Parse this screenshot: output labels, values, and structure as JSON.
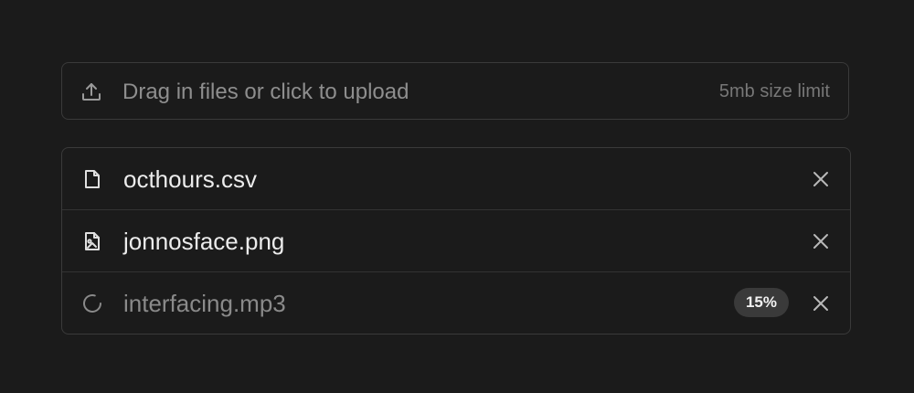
{
  "upload": {
    "prompt": "Drag in files or click to upload",
    "limit": "5mb size limit",
    "icon": "upload-icon"
  },
  "files": [
    {
      "name": "octhours.csv",
      "icon": "file-icon",
      "status": "complete"
    },
    {
      "name": "jonnosface.png",
      "icon": "image-file-icon",
      "status": "complete"
    },
    {
      "name": "interfacing.mp3",
      "icon": "spinner-icon",
      "status": "uploading",
      "progress_label": "15%",
      "progress": 0.15
    }
  ],
  "colors": {
    "background": "#1b1b1b",
    "border": "#3a3a3a",
    "text": "#ececec",
    "muted_text": "#8a8a8a",
    "badge_bg": "#3a3a3a"
  }
}
